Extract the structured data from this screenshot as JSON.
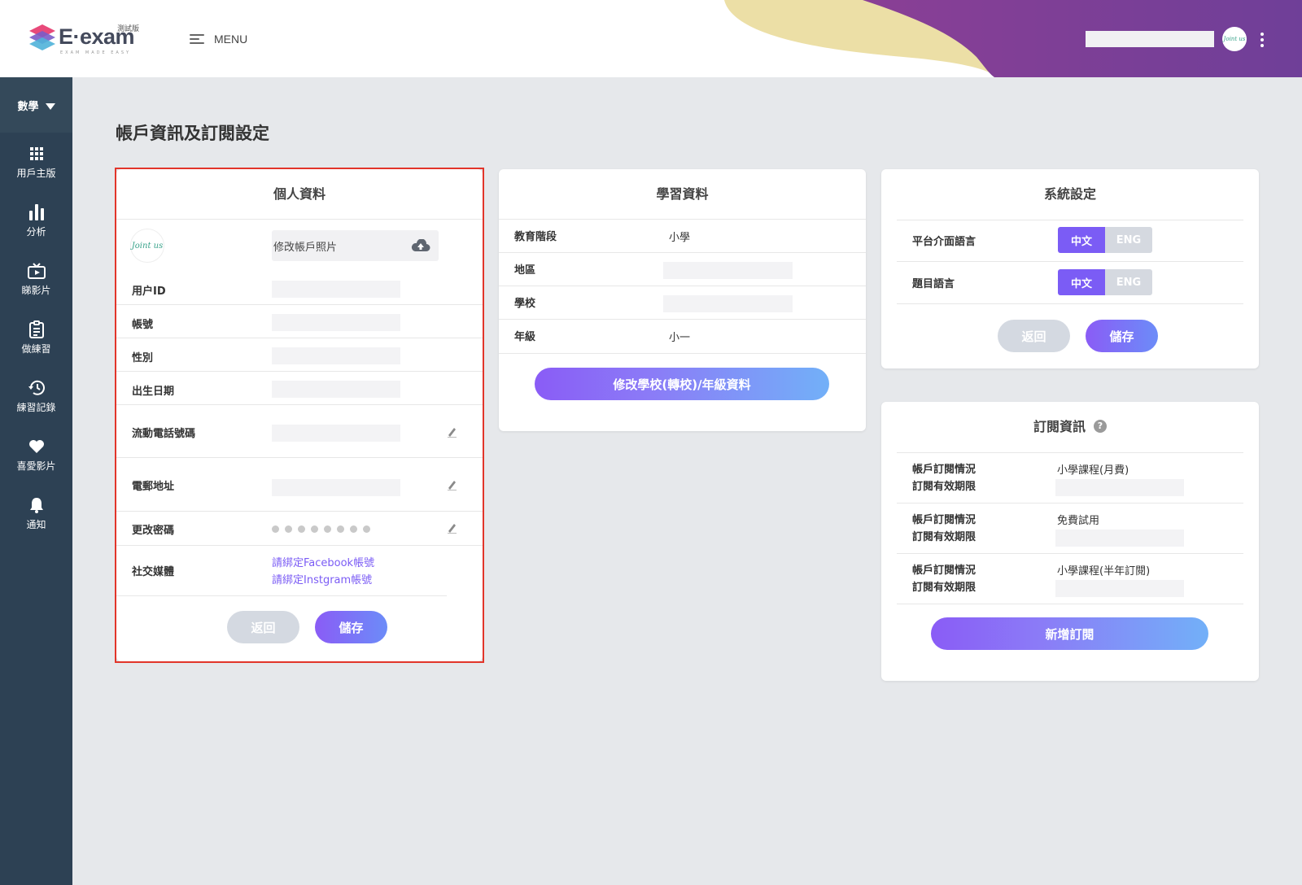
{
  "header": {
    "logo_text": "E·exam",
    "logo_beta": "測試版",
    "logo_tagline": "EXAM MADE EASY",
    "menu_label": "MENU",
    "avatar_text": "Joint us"
  },
  "sidebar": {
    "subject": "數學",
    "items": [
      {
        "label": "用戶主版",
        "icon": "grid-icon"
      },
      {
        "label": "分析",
        "icon": "bar-chart-icon"
      },
      {
        "label": "睇影片",
        "icon": "tv-icon"
      },
      {
        "label": "做練習",
        "icon": "clipboard-icon"
      },
      {
        "label": "練習記錄",
        "icon": "history-icon"
      },
      {
        "label": "喜愛影片",
        "icon": "heart-icon"
      },
      {
        "label": "通知",
        "icon": "bell-icon"
      }
    ]
  },
  "page": {
    "title": "帳戶資訊及訂閱設定"
  },
  "personal": {
    "title": "個人資料",
    "avatar_text": "Joint us",
    "upload_label": "修改帳戶照片",
    "fields": {
      "user_id": "用户ID",
      "account": "帳號",
      "gender": "性別",
      "birthday": "出生日期",
      "phone": "流動電話號碼",
      "email": "電郵地址",
      "password": "更改密碼",
      "social": "社交媒體"
    },
    "facebook_link": "請綁定Facebook帳號",
    "instagram_link": "請綁定Instgram帳號",
    "back_label": "返回",
    "save_label": "儲存"
  },
  "learning": {
    "title": "學習資料",
    "stage_label": "教育階段",
    "stage_value": "小學",
    "region_label": "地區",
    "school_label": "學校",
    "grade_label": "年級",
    "grade_value": "小一",
    "change_button": "修改學校(轉校)/年級資料"
  },
  "system": {
    "title": "系統設定",
    "ui_lang_label": "平台介面語言",
    "question_lang_label": "題目語言",
    "opt_zh": "中文",
    "opt_en": "ENG",
    "ui_lang_selected": "中文",
    "question_lang_selected": "中文",
    "back_label": "返回",
    "save_label": "儲存"
  },
  "subscription": {
    "title": "訂閱資訊",
    "help_icon": "?",
    "status_label": "帳戶訂閱情況",
    "expiry_label": "訂閱有效期限",
    "plans": [
      "小學課程(月費)",
      "免費試用",
      "小學課程(半年訂閱)"
    ],
    "add_button": "新增訂閱"
  },
  "colors": {
    "sidebar": "#2d4154",
    "accent": "#7b5cf5",
    "highlight": "#e2352a"
  }
}
